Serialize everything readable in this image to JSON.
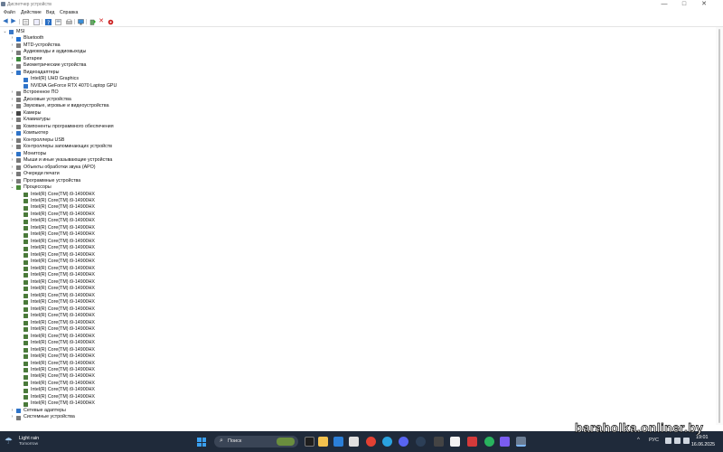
{
  "window": {
    "title": "Диспетчер устройств",
    "controls": {
      "minimize": "—",
      "maximize": "□",
      "close": "✕"
    }
  },
  "menu": [
    "Файл",
    "Действие",
    "Вид",
    "Справка"
  ],
  "toolbar_icons": [
    "back-icon",
    "forward-icon",
    "properties-icon",
    "list-icon",
    "help-icon",
    "show-hidden-icon",
    "monitor-icon",
    "update-driver-icon",
    "uninstall-icon",
    "disable-icon"
  ],
  "tree": {
    "root": "MSI",
    "categories_before": [
      {
        "label": "Bluetooth",
        "color": "#1f6fd1"
      },
      {
        "label": "MTD-устройства",
        "color": "#7a7a7a"
      },
      {
        "label": "Аудиовходы и аудиовыходы",
        "color": "#7a7a7a"
      },
      {
        "label": "Батареи",
        "color": "#3b8a3b"
      },
      {
        "label": "Биометрические устройства",
        "color": "#7a7a7a"
      }
    ],
    "video": {
      "label": "Видеоадаптеры",
      "children": [
        "Intel(R) UHD Graphics",
        "NVIDIA GeForce RTX 4070 Laptop GPU"
      ]
    },
    "categories_mid": [
      {
        "label": "Встроенное ПО",
        "color": "#7a7a7a"
      },
      {
        "label": "Дисковые устройства",
        "color": "#7a7a7a"
      },
      {
        "label": "Звуковые, игровые и видеоустройства",
        "color": "#7a7a7a"
      },
      {
        "label": "Камеры",
        "color": "#444"
      },
      {
        "label": "Клавиатуры",
        "color": "#7a7a7a"
      },
      {
        "label": "Компоненты программного обеспечения",
        "color": "#7a7a7a"
      },
      {
        "label": "Компьютер",
        "color": "#2f74c9"
      },
      {
        "label": "Контроллеры USB",
        "color": "#7a7a7a"
      },
      {
        "label": "Контроллеры запоминающих устройств",
        "color": "#7a7a7a"
      },
      {
        "label": "Мониторы",
        "color": "#2f74c9"
      },
      {
        "label": "Мыши и иные указывающие устройства",
        "color": "#7a7a7a"
      },
      {
        "label": "Объекты обработки звука (APO)",
        "color": "#7a7a7a"
      },
      {
        "label": "Очереди печати",
        "color": "#7a7a7a"
      },
      {
        "label": "Программные устройства",
        "color": "#7a7a7a"
      }
    ],
    "processors": {
      "label": "Процессоры",
      "child_label": "Intel(R) Core(TM) i9-14900HX",
      "count": 32
    },
    "categories_after": [
      {
        "label": "Сетевые адаптеры",
        "color": "#2f74c9"
      },
      {
        "label": "Системные устройства",
        "color": "#7a7a7a"
      }
    ]
  },
  "taskbar": {
    "weather": {
      "title": "Light rain",
      "subtitle": "Tomorrow"
    },
    "search_placeholder": "Поиск",
    "apps": [
      "file-explorer-icon",
      "store-icon",
      "chrome-icon",
      "telegram-icon",
      "discord-icon",
      "steam-icon",
      "app-icon",
      "game-icon",
      "media-icon",
      "device-manager-icon"
    ],
    "tray": {
      "arrow": "^",
      "lang": "РУС",
      "time": "19:01",
      "date": "16.06.2025"
    }
  },
  "watermark": "baraholka.onliner.by"
}
